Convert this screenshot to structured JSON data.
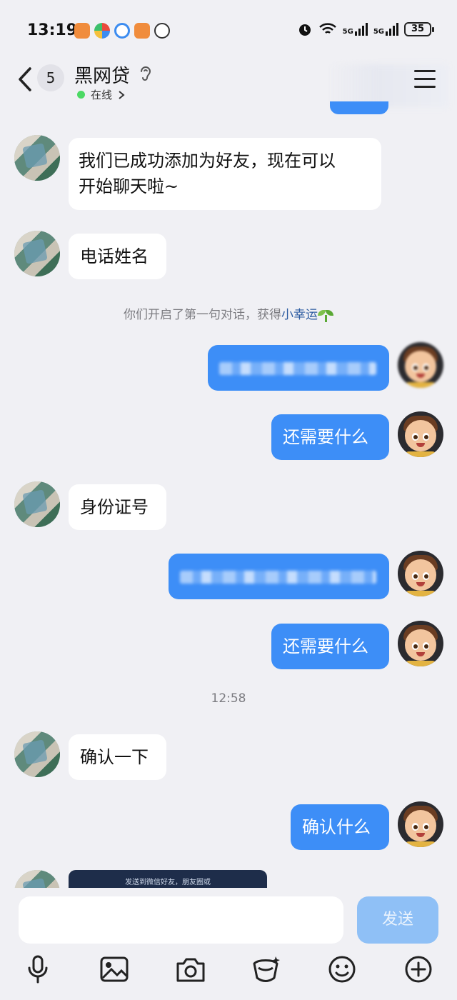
{
  "status_bar": {
    "time": "13:19",
    "net1": "5G",
    "net2": "5G",
    "battery": "35"
  },
  "header": {
    "unread_count": "5",
    "title": "黑网贷",
    "online_label": "在线",
    "menu_icon": "hamburger-menu-icon"
  },
  "messages": [
    {
      "side": "other",
      "text_line1": "我们已成功添加为好友，现在可以",
      "text_line2": "开始聊天啦~"
    },
    {
      "side": "other",
      "text": "电话姓名"
    },
    {
      "side": "me",
      "text": ""
    },
    {
      "side": "me",
      "text": "还需要什么"
    },
    {
      "side": "other",
      "text": "身份证号"
    },
    {
      "side": "me",
      "text": ""
    },
    {
      "side": "me",
      "text": "还需要什么"
    },
    {
      "side": "other",
      "text": "确认一下"
    },
    {
      "side": "me",
      "text": "确认什么"
    },
    {
      "side": "other",
      "image_caption": "发送到微信好友，朋友圈或"
    }
  ],
  "system": {
    "first_chat_prefix": "你们开启了第一句对话，获得",
    "first_chat_highlight": "小幸运",
    "timestamp": "12:58"
  },
  "composer": {
    "send_label": "发送"
  },
  "toolbar": [
    "microphone-icon",
    "image-icon",
    "camera-icon",
    "red-packet-icon",
    "emoji-icon",
    "plus-icon"
  ]
}
